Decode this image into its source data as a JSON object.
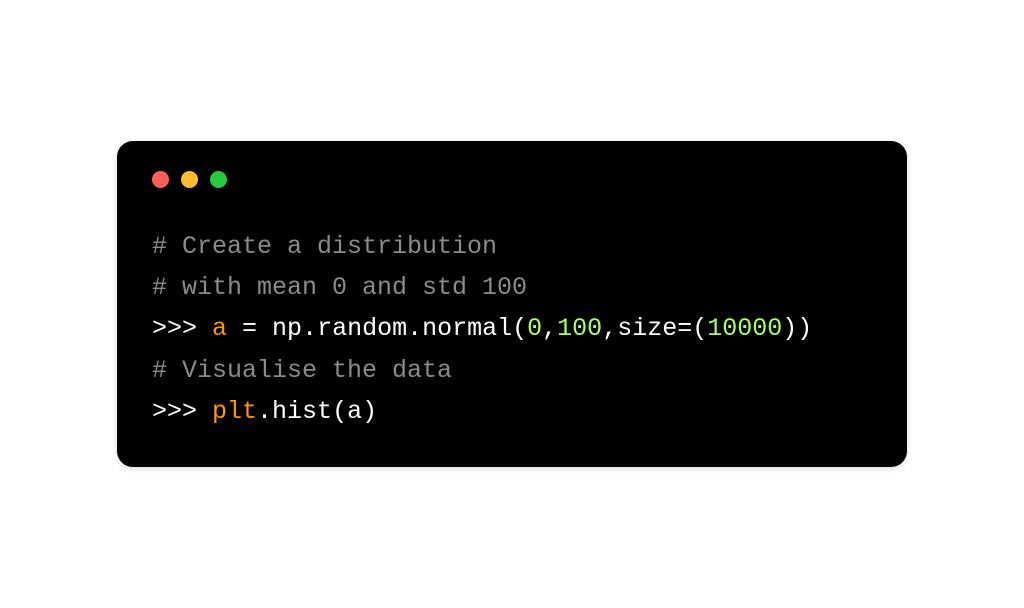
{
  "terminal": {
    "controls": {
      "close": "close",
      "minimize": "minimize",
      "maximize": "maximize"
    },
    "lines": {
      "comment1": "# Create a distribution",
      "comment2": "# with mean 0 and std 100",
      "prompt1": ">>> ",
      "var_a": "a",
      "equals": " = ",
      "np": "np",
      "dot1": ".",
      "random": "random",
      "dot2": ".",
      "normal": "normal",
      "lparen1": "(",
      "num0": "0",
      "comma1": ",",
      "num100": "100",
      "comma2": ",",
      "size": "size",
      "eq2": "=",
      "lparen2": "(",
      "num10000": "10000",
      "rparen2": ")",
      "rparen1": ")",
      "comment3": "# Visualise the data",
      "prompt2": ">>> ",
      "plt": "plt",
      "dot3": ".",
      "hist": "hist",
      "lparen3": "(",
      "var_a2": "a",
      "rparen3": ")"
    }
  }
}
